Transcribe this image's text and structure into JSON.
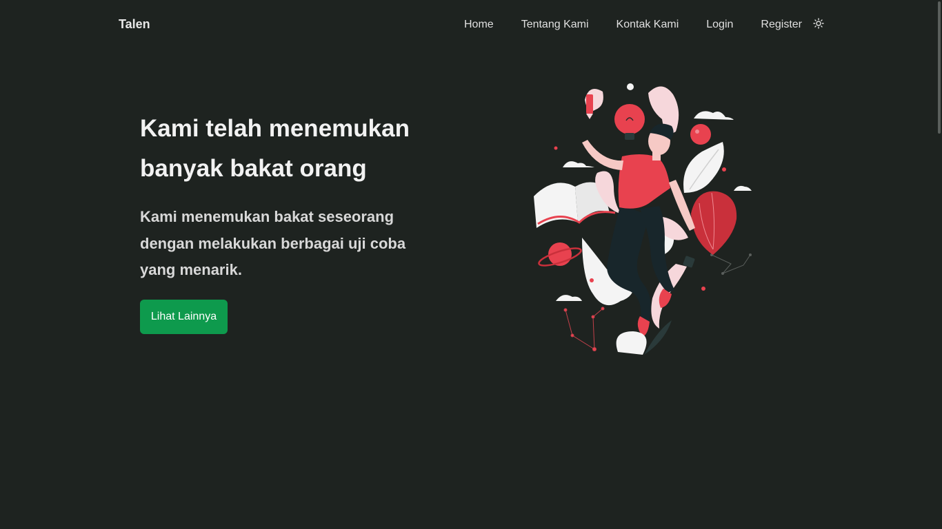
{
  "navbar": {
    "brand": "Talen",
    "links": [
      "Home",
      "Tentang Kami",
      "Kontak Kami",
      "Login",
      "Register"
    ],
    "theme_icon": "sun-icon"
  },
  "hero": {
    "title": "Kami telah menemukan banyak bakat orang",
    "subtitle": "Kami menemukan bakat seseorang dengan melakukan berbagai uji coba yang menarik.",
    "button_label": "Lihat Lainnya",
    "illustration": "person-floating-with-ideas-illustration"
  },
  "colors": {
    "background": "#1e2320",
    "accent": "#0e9a4d",
    "illustration_red": "#e8424f",
    "illustration_light": "#f6d7db"
  }
}
